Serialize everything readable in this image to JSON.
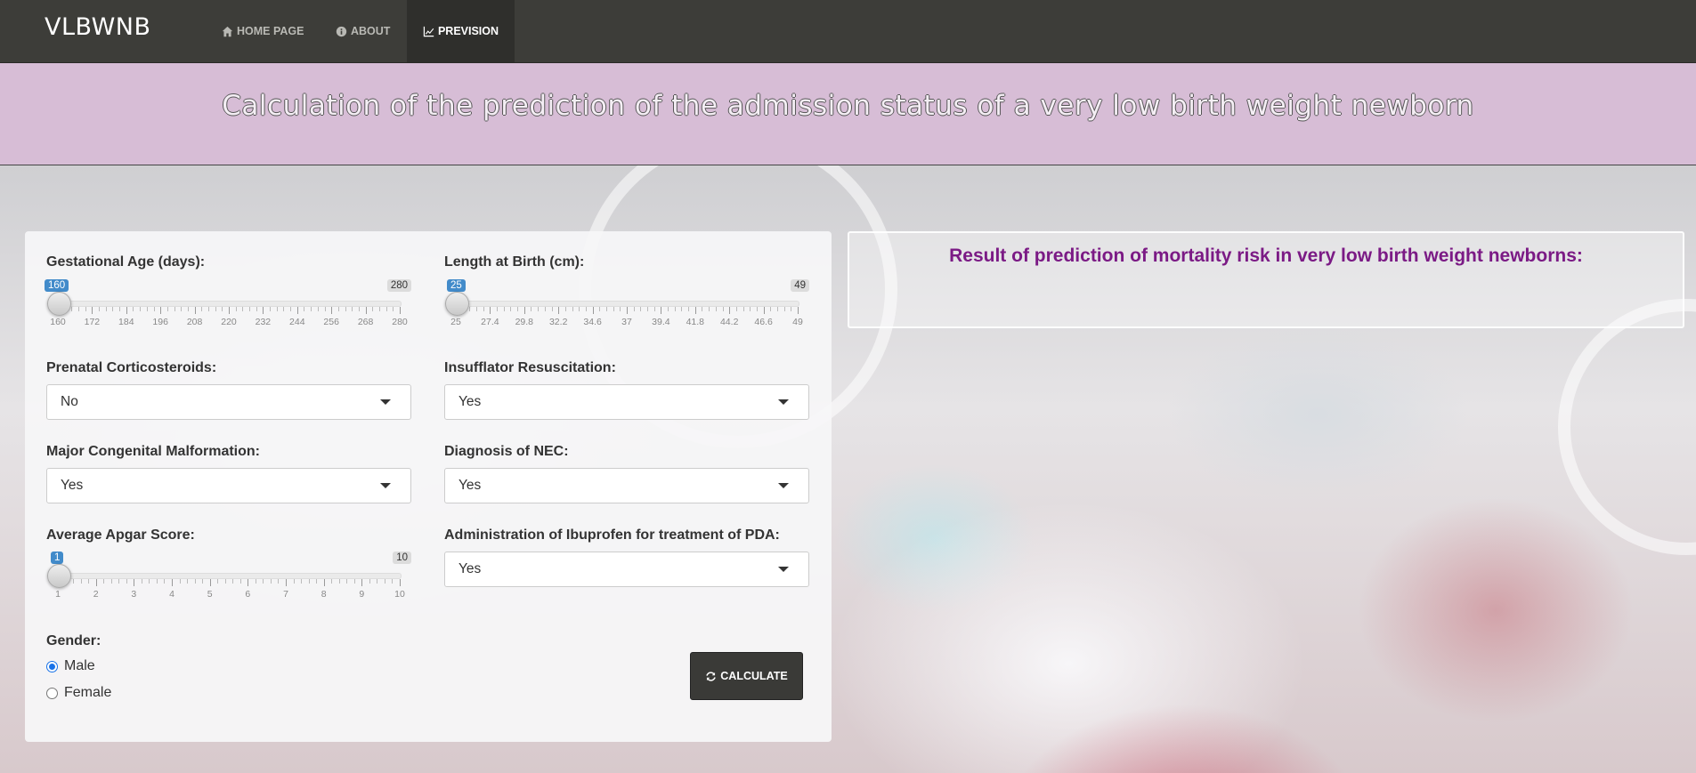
{
  "app": {
    "brand": "VLBWNB"
  },
  "nav": {
    "home": "HOME PAGE",
    "about": "ABOUT",
    "prevision": "PREVISION"
  },
  "banner": {
    "title": "Calculation of the prediction of the admission status of a very low birth weight newborn"
  },
  "form": {
    "gestational_age": {
      "label": "Gestational Age (days):",
      "value": "160",
      "max": "280",
      "ticks": [
        "160",
        "172",
        "184",
        "196",
        "208",
        "220",
        "232",
        "244",
        "256",
        "268",
        "280"
      ]
    },
    "length_at_birth": {
      "label": "Length at Birth (cm):",
      "value": "25",
      "max": "49",
      "ticks": [
        "25",
        "27.4",
        "29.8",
        "32.2",
        "34.6",
        "37",
        "39.4",
        "41.8",
        "44.2",
        "46.6",
        "49"
      ]
    },
    "prenatal_corticosteroids": {
      "label": "Prenatal Corticosteroids:",
      "value": "No"
    },
    "insufflator_resuscitation": {
      "label": "Insufflator Resuscitation:",
      "value": "Yes"
    },
    "major_congenital_malformation": {
      "label": "Major Congenital Malformation:",
      "value": "Yes"
    },
    "diagnosis_nec": {
      "label": "Diagnosis of NEC:",
      "value": "Yes"
    },
    "apgar": {
      "label": "Average Apgar Score:",
      "value": "1",
      "max": "10",
      "ticks": [
        "1",
        "2",
        "3",
        "4",
        "5",
        "6",
        "7",
        "8",
        "9",
        "10"
      ]
    },
    "ibuprofen_pda": {
      "label": "Administration of Ibuprofen for treatment of PDA:",
      "value": "Yes"
    },
    "gender": {
      "label": "Gender:",
      "options": [
        "Male",
        "Female"
      ],
      "selected": "Male"
    },
    "calculate_label": "CALCULATE"
  },
  "result": {
    "heading": "Result of prediction of mortality risk in very low birth weight newborns:"
  },
  "icons": {
    "home": "home-icon",
    "about": "info-icon",
    "prevision": "line-chart-icon",
    "calculate": "refresh-icon"
  },
  "colors": {
    "navbar": "#3d3d39",
    "banner": "#d7bdd6",
    "result_heading": "#7b1a85",
    "slider_accent": "#428bca"
  }
}
